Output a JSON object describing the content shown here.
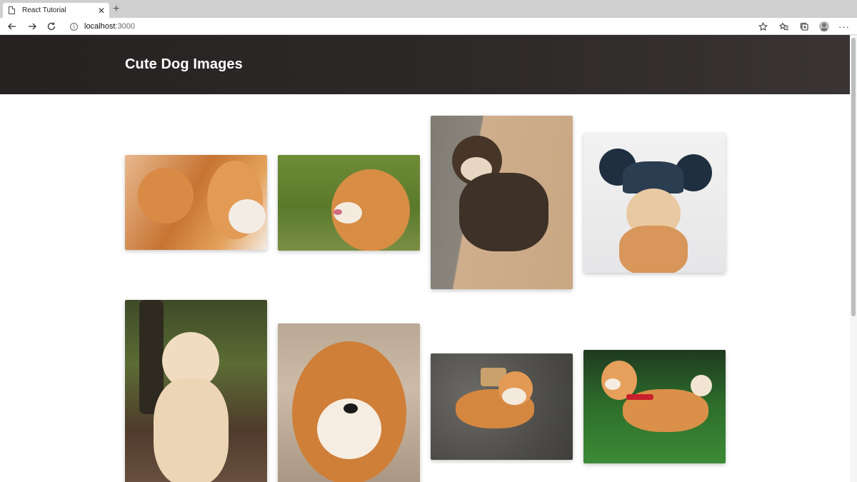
{
  "browser": {
    "tab_title": "React Tutorial",
    "url_host": "localhost",
    "url_port": ":3000",
    "icons": [
      "back-icon",
      "forward-icon",
      "refresh-icon",
      "info-icon",
      "star-icon",
      "favorites-icon",
      "collections-icon",
      "profile-icon",
      "more-icon"
    ]
  },
  "page": {
    "heading": "Cute Dog Images",
    "gallery": [
      {
        "subject": "shiba inu close-up",
        "palette": [
          "#e3a15a",
          "#c9752f",
          "#f5efe8"
        ]
      },
      {
        "subject": "shiba licking nose on grass",
        "palette": [
          "#5f7d2f",
          "#d88d45",
          "#f6ede3"
        ]
      },
      {
        "subject": "black and tan shiba on sand",
        "palette": [
          "#c9a98a",
          "#4a3a2c",
          "#7d7a72"
        ]
      },
      {
        "subject": "shiba wearing mouse-ear hat",
        "palette": [
          "#eeeeee",
          "#27384a",
          "#e1a86d"
        ]
      },
      {
        "subject": "cream shiba in forest",
        "palette": [
          "#4e5b34",
          "#f0dfc6",
          "#6b4a36"
        ]
      },
      {
        "subject": "smiling shiba face",
        "palette": [
          "#c9b7a5",
          "#d2843d",
          "#f7efe5"
        ]
      },
      {
        "subject": "shiba lying on gravel",
        "palette": [
          "#5c5b57",
          "#d4873f",
          "#f0e6d9"
        ]
      },
      {
        "subject": "shiba with red harness on grass",
        "palette": [
          "#2e6f2b",
          "#d98e47",
          "#c8202a"
        ]
      }
    ]
  },
  "colors": {
    "hero_bg": "#2b2626",
    "hero_text": "#ffffff",
    "tabstrip": "#cfcfcf"
  }
}
